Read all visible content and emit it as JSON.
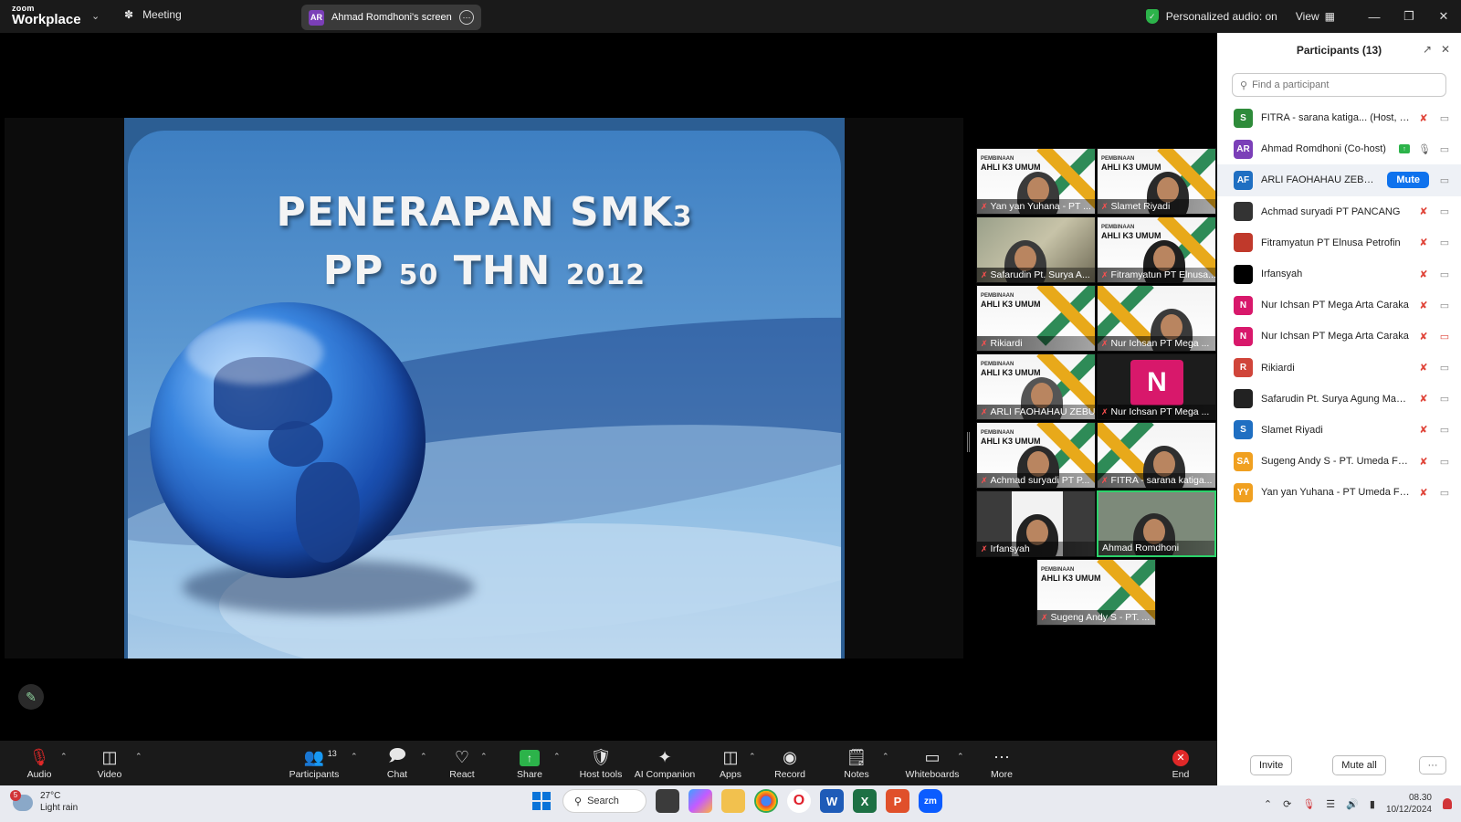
{
  "titlebar": {
    "logo_line1": "zoom",
    "logo_line2": "Workplace",
    "meeting_label": "Meeting",
    "screen_initials": "AR",
    "screen_label": "Ahmad Romdhoni's screen",
    "audio_status": "Personalized audio: on",
    "view_label": "View"
  },
  "slide": {
    "title_line1_a": "PENERAPAN SMK",
    "title_line1_b": "3",
    "title_line2_a": "PP ",
    "title_line2_b": "50",
    "title_line2_c": " THN ",
    "title_line2_d": "2012"
  },
  "gallery": [
    {
      "name": "Yan yan Yuhana - PT ..."
    },
    {
      "name": "Slamet Riyadi"
    },
    {
      "name": "Safarudin Pt. Surya A..."
    },
    {
      "name": "Fitramyatun PT Elnusa..."
    },
    {
      "name": "Rikiardi"
    },
    {
      "name": "Nur Ichsan PT Mega ..."
    },
    {
      "name": "ARLI FAOHAHAU ZEBUA-..."
    },
    {
      "name": "Nur Ichsan PT Mega ...",
      "initial": "N"
    },
    {
      "name": "Achmad suryadi PT P..."
    },
    {
      "name": "FITRA - sarana katiga..."
    },
    {
      "name": "Irfansyah"
    },
    {
      "name": "Ahmad Romdhoni"
    },
    {
      "name": "Sugeng Andy S - PT. ..."
    }
  ],
  "banner": {
    "small": "PEMBINAAN",
    "big": "AHLI K3 UMUM"
  },
  "participants_panel": {
    "title": "Participants (13)",
    "search_placeholder": "Find a participant",
    "mute_label": "Mute",
    "invite_label": "Invite",
    "mute_all_label": "Mute all",
    "more_label": "···",
    "items": [
      {
        "initials": "S",
        "color": "#2e8b3a",
        "name": "FITRA - sarana katiga...  (Host, me)"
      },
      {
        "initials": "AR",
        "color": "#7b3fb8",
        "name": "Ahmad Romdhoni (Co-host)"
      },
      {
        "initials": "AF",
        "color": "#1f6fc2",
        "name": "ARLI FAOHAHAU ZEBUA-P..."
      },
      {
        "initials": "",
        "color": "#333333",
        "name": "Achmad suryadi PT PANCANG"
      },
      {
        "initials": "",
        "color": "#c0392b",
        "name": "Fitramyatun PT Elnusa Petrofin"
      },
      {
        "initials": "",
        "color": "#000000",
        "name": "Irfansyah"
      },
      {
        "initials": "N",
        "color": "#d8186b",
        "name": "Nur Ichsan PT Mega Arta Caraka"
      },
      {
        "initials": "N",
        "color": "#d8186b",
        "name": "Nur Ichsan PT Mega Arta Caraka"
      },
      {
        "initials": "R",
        "color": "#d0453a",
        "name": "Rikiardi"
      },
      {
        "initials": "",
        "color": "#222222",
        "name": "Safarudin Pt. Surya Agung Manu..."
      },
      {
        "initials": "S",
        "color": "#1f6fc2",
        "name": "Slamet Riyadi"
      },
      {
        "initials": "SA",
        "color": "#f0a020",
        "name": "Sugeng Andy S - PT. Umeda Fac..."
      },
      {
        "initials": "YY",
        "color": "#f0a020",
        "name": "Yan yan Yuhana - PT Umeda Fact..."
      }
    ]
  },
  "toolbar": {
    "audio": "Audio",
    "video": "Video",
    "participants": "Participants",
    "participants_count": "13",
    "chat": "Chat",
    "react": "React",
    "share": "Share",
    "host_tools": "Host tools",
    "ai_companion": "AI Companion",
    "apps": "Apps",
    "record": "Record",
    "notes": "Notes",
    "whiteboards": "Whiteboards",
    "more": "More",
    "end": "End"
  },
  "taskbar": {
    "weather_badge": "5",
    "temperature": "27°C",
    "weather_desc": "Light rain",
    "search_label": "Search",
    "time": "08.30",
    "date": "10/12/2024"
  },
  "colors": {
    "accent_blue": "#0e72ed",
    "active_green": "#2cd36b",
    "muted_red": "#e0453a"
  }
}
